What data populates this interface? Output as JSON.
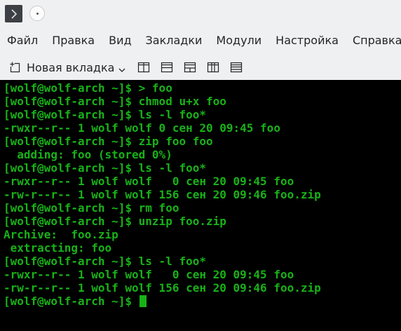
{
  "menubar": {
    "items": [
      "Файл",
      "Правка",
      "Вид",
      "Закладки",
      "Модули",
      "Настройка",
      "Справка"
    ]
  },
  "toolbar": {
    "new_tab_label": "Новая вкладка",
    "icons": [
      "split-left-right-icon",
      "split-top-bottom-icon",
      "split-auto-icon",
      "close-split-left-right-icon",
      "close-split-top-bottom-icon"
    ]
  },
  "terminal": {
    "color": "#18b218",
    "background": "#000000",
    "lines": [
      "[wolf@wolf-arch ~]$ > foo",
      "[wolf@wolf-arch ~]$ chmod u+x foo",
      "[wolf@wolf-arch ~]$ ls -l foo*",
      "-rwxr--r-- 1 wolf wolf 0 сен 20 09:45 foo",
      "[wolf@wolf-arch ~]$ zip foo foo",
      "  adding: foo (stored 0%)",
      "[wolf@wolf-arch ~]$ ls -l foo*",
      "-rwxr--r-- 1 wolf wolf   0 сен 20 09:45 foo",
      "-rw-r--r-- 1 wolf wolf 156 сен 20 09:46 foo.zip",
      "[wolf@wolf-arch ~]$ rm foo",
      "[wolf@wolf-arch ~]$ unzip foo.zip",
      "Archive:  foo.zip",
      " extracting: foo",
      "[wolf@wolf-arch ~]$ ls -l foo*",
      "-rwxr--r-- 1 wolf wolf   0 сен 20 09:45 foo",
      "-rw-r--r-- 1 wolf wolf 156 сен 20 09:46 foo.zip"
    ],
    "prompt": "[wolf@wolf-arch ~]$ "
  }
}
